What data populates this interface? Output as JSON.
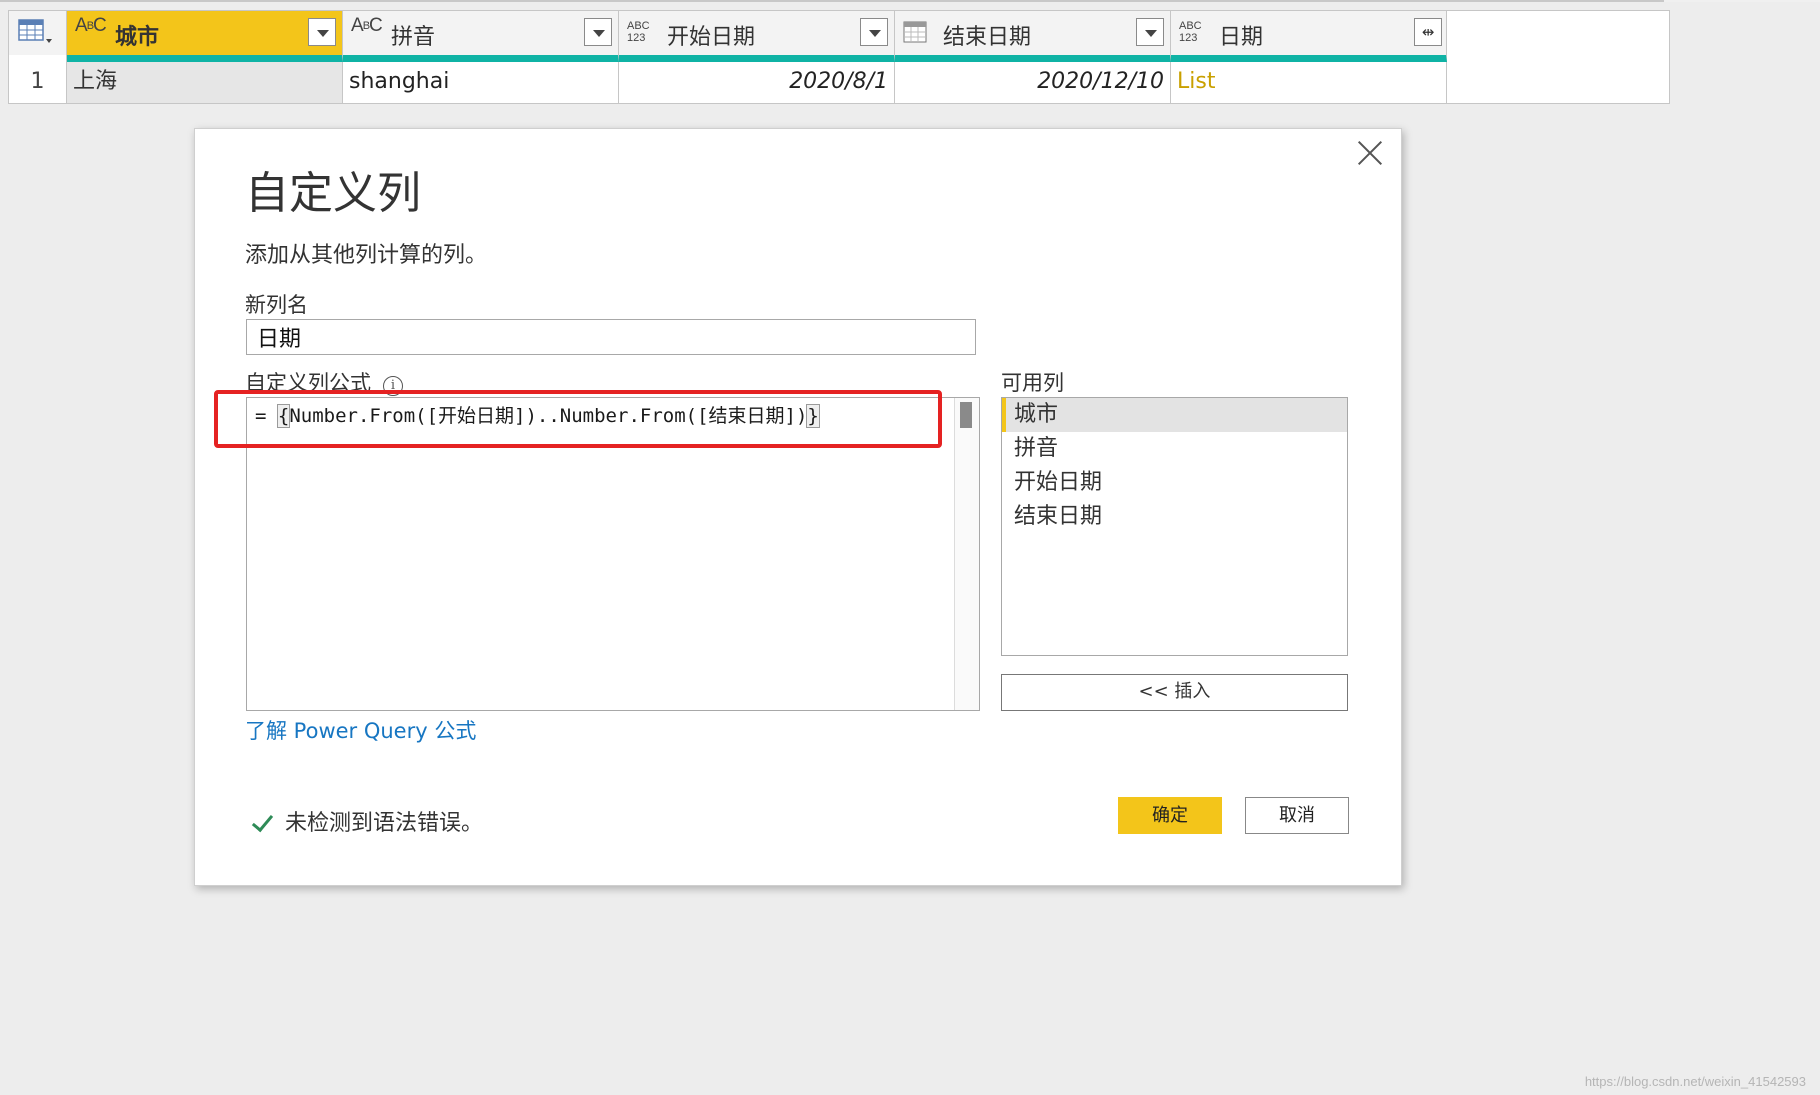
{
  "grid": {
    "columns": [
      {
        "name": "城市",
        "type_icon": "ABC"
      },
      {
        "name": "拼音",
        "type_icon": "ABC"
      },
      {
        "name": "开始日期",
        "type_icon": "ABC\n123"
      },
      {
        "name": "结束日期",
        "type_icon": "calendar-icon"
      },
      {
        "name": "日期",
        "type_icon": "ABC\n123"
      }
    ],
    "row": {
      "num": "1",
      "city": "上海",
      "pinyin": "shanghai",
      "start": "2020/8/1",
      "end": "2020/12/10",
      "date": "List"
    }
  },
  "dialog": {
    "title": "自定义列",
    "subtitle": "添加从其他列计算的列。",
    "new_col_label": "新列名",
    "new_col_value": "日期",
    "formula_label": "自定义列公式",
    "formula_prefix": "= ",
    "formula_open": "{",
    "formula_body": "Number.From([开始日期])..Number.From([结束日期])",
    "formula_close": "}",
    "available_label": "可用列",
    "available": [
      "城市",
      "拼音",
      "开始日期",
      "结束日期"
    ],
    "insert_label": "<< 插入",
    "learn_link": "了解 Power Query 公式",
    "status": "未检测到语法错误。",
    "ok_label": "确定",
    "cancel_label": "取消"
  },
  "watermark": "https://blog.csdn.net/weixin_41542593",
  "colors": {
    "accent": "#f3c51a",
    "column_quality": "#0fb3a5",
    "highlight": "#e52222",
    "link": "#1776c2",
    "list_text": "#c9a000"
  }
}
